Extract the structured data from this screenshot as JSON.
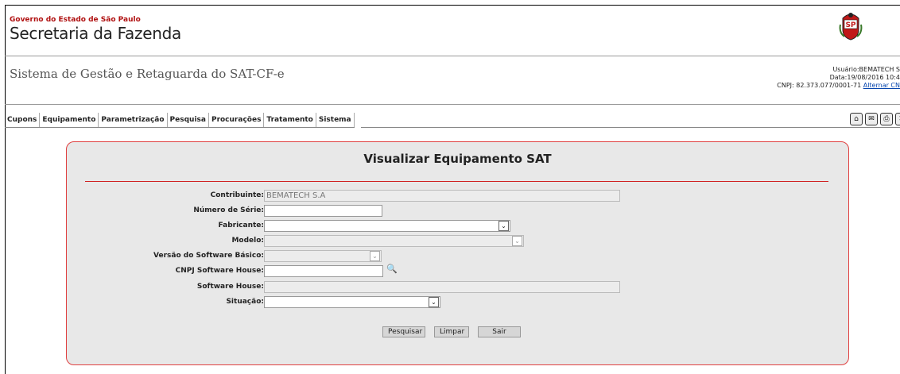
{
  "header": {
    "government": "Governo do Estado de São Paulo",
    "secretariat": "Secretaria da Fazenda",
    "system_title": "Sistema de Gestão e Retaguarda do SAT-CF-e",
    "logo_text": "SP"
  },
  "user": {
    "usuario": "Usuário:BEMATECH S",
    "data": "Data:19/08/2016 10:4",
    "cnpj": "CNPJ: 82.373.077/0001-71",
    "alternar": "Alternar CN"
  },
  "menu": [
    "Cupons",
    "Equipamento",
    "Parametrização",
    "Pesquisa",
    "Procurações",
    "Tratamento",
    "Sistema"
  ],
  "toolbar_icons": [
    "home-icon",
    "mail-icon",
    "print-icon",
    "close-icon"
  ],
  "form": {
    "title": "Visualizar Equipamento SAT",
    "contribuinte_label": "Contribuinte:",
    "contribuinte_value": "BEMATECH S.A",
    "numero_serie_label": "Número de Série:",
    "numero_serie_value": "",
    "fabricante_label": "Fabricante:",
    "fabricante_value": "",
    "modelo_label": "Modelo:",
    "modelo_value": "",
    "versao_label": "Versão do Software Básico:",
    "versao_value": "",
    "cnpj_sh_label": "CNPJ Software House:",
    "cnpj_sh_value": "",
    "software_house_label": "Software House:",
    "software_house_value": "",
    "situacao_label": "Situação:",
    "situacao_value": ""
  },
  "buttons": {
    "pesquisar": "Pesquisar",
    "limpar": "Limpar",
    "sair": "Sair"
  }
}
